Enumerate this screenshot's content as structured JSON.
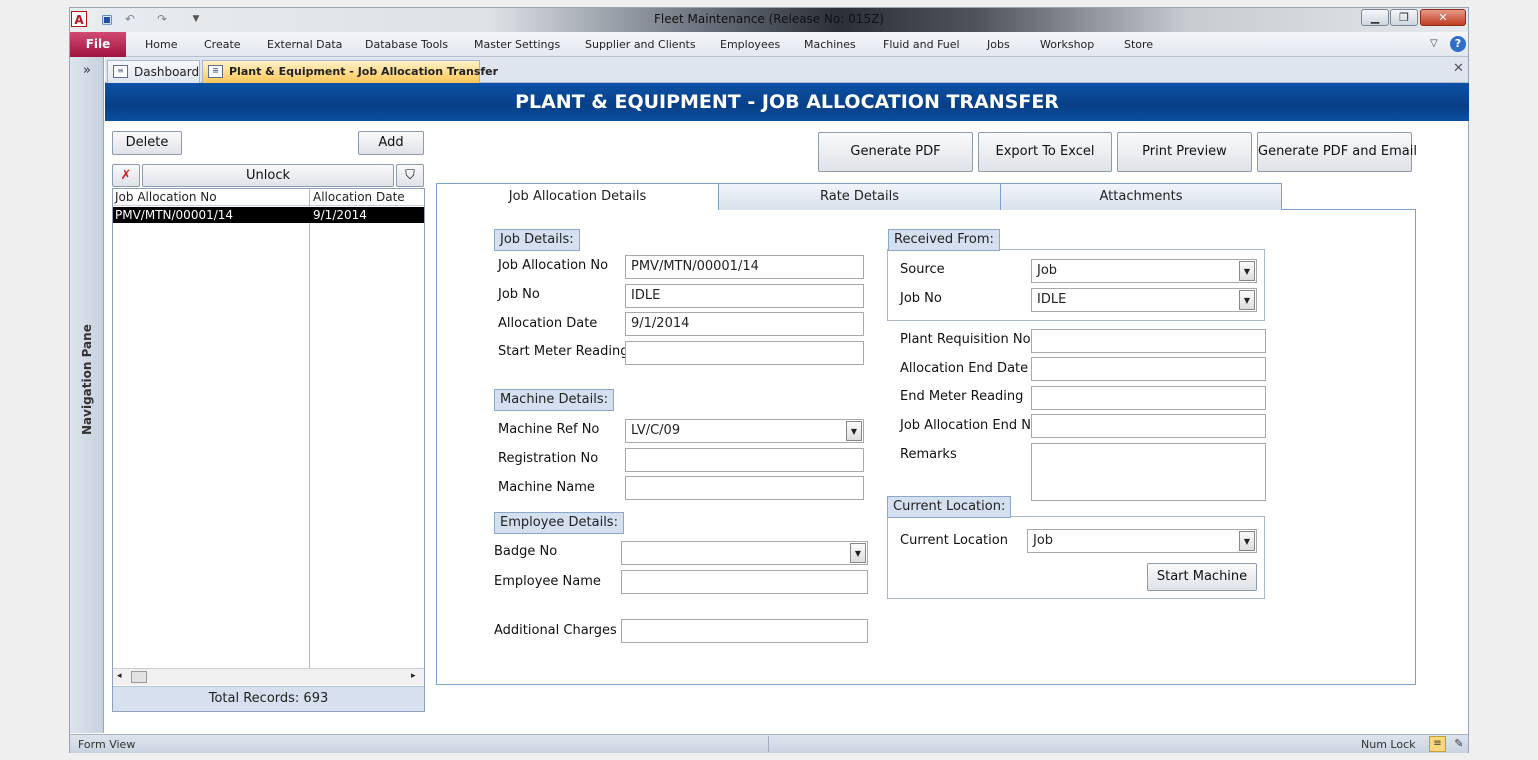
{
  "window": {
    "title": "Fleet Maintenance (Release No: 015Z)",
    "app_icon_letter": "A",
    "icons": {
      "save": "save-icon",
      "undo": "undo-icon",
      "redo": "redo-icon"
    }
  },
  "ribbon": {
    "file": "File",
    "tabs": [
      "Home",
      "Create",
      "External Data",
      "Database Tools",
      "Master Settings",
      "Supplier and Clients",
      "Employees",
      "Machines",
      "Fluid and Fuel",
      "Jobs",
      "Workshop",
      "Store"
    ]
  },
  "nav_pane": {
    "label": "Navigation Pane",
    "chevron": "»"
  },
  "doc_tabs": [
    {
      "label": "Dashboard"
    },
    {
      "label": "Plant & Equipment - Job Allocation Transfer"
    }
  ],
  "banner": {
    "title": "PLANT & EQUIPMENT - JOB ALLOCATION TRANSFER"
  },
  "list_panel": {
    "delete": "Delete",
    "add": "Add",
    "unlock": "Unlock",
    "columns": [
      "Job Allocation No",
      "Allocation Date"
    ],
    "rows": [
      [
        "PMV/MTN/00001/14",
        "9/1/2014"
      ]
    ],
    "total": "Total Records: 693"
  },
  "actions": {
    "generate_pdf": "Generate PDF",
    "export_excel": "Export To Excel",
    "print_preview": "Print Preview",
    "pdf_email": "Generate PDF and Email"
  },
  "form_tabs": [
    "Job Allocation Details",
    "Rate Details",
    "Attachments"
  ],
  "job_details": {
    "header": "Job Details:",
    "job_allocation_no_label": "Job Allocation No",
    "job_allocation_no": "PMV/MTN/00001/14",
    "job_no_label": "Job No",
    "job_no": "IDLE",
    "allocation_date_label": "Allocation Date",
    "allocation_date": "9/1/2014",
    "start_meter_label": "Start Meter Reading",
    "start_meter": ""
  },
  "machine_details": {
    "header": "Machine Details:",
    "ref_no_label": "Machine Ref No",
    "ref_no": "LV/C/09",
    "registration_label": "Registration No",
    "registration": "",
    "name_label": "Machine Name",
    "name": ""
  },
  "employee_details": {
    "header": "Employee Details:",
    "badge_label": "Badge No",
    "badge": "",
    "name_label": "Employee Name",
    "name": "",
    "additional_label": "Additional Charges",
    "additional": ""
  },
  "received_from": {
    "header": "Received From:",
    "source_label": "Source",
    "source": "Job",
    "job_no_label": "Job No",
    "job_no": "IDLE"
  },
  "extra": {
    "plant_req_label": "Plant Requisition No.",
    "alloc_end_label": "Allocation End Date",
    "end_meter_label": "End Meter Reading",
    "job_alloc_end_label": "Job Allocation End No",
    "remarks_label": "Remarks"
  },
  "current_location": {
    "header": "Current Location:",
    "label": "Current Location",
    "value": "Job",
    "start_machine": "Start Machine"
  },
  "status": {
    "view": "Form View",
    "numlock": "Num Lock"
  }
}
